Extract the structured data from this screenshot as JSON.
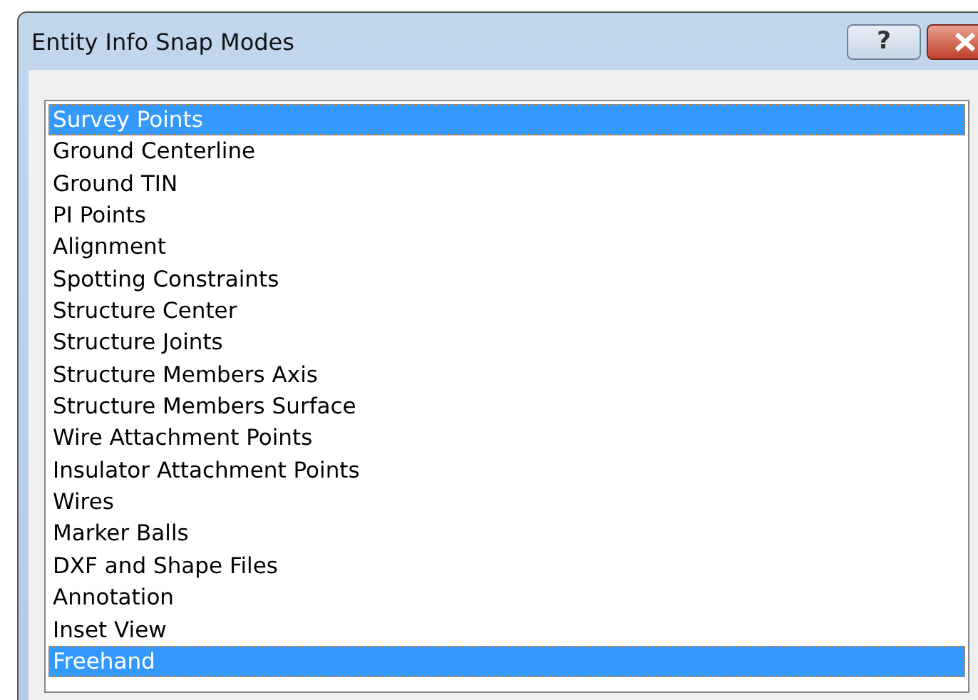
{
  "window": {
    "title": "Entity Info Snap Modes",
    "help_button": "?"
  },
  "snap_modes": [
    {
      "label": "Survey Points",
      "selected": true
    },
    {
      "label": "Ground Centerline",
      "selected": false
    },
    {
      "label": "Ground TIN",
      "selected": false
    },
    {
      "label": "PI Points",
      "selected": false
    },
    {
      "label": "Alignment",
      "selected": false
    },
    {
      "label": "Spotting Constraints",
      "selected": false
    },
    {
      "label": "Structure Center",
      "selected": false
    },
    {
      "label": "Structure Joints",
      "selected": false
    },
    {
      "label": "Structure Members Axis",
      "selected": false
    },
    {
      "label": "Structure Members Surface",
      "selected": false
    },
    {
      "label": "Wire Attachment Points",
      "selected": false
    },
    {
      "label": "Insulator Attachment Points",
      "selected": false
    },
    {
      "label": "Wires",
      "selected": false
    },
    {
      "label": "Marker Balls",
      "selected": false
    },
    {
      "label": "DXF and Shape Files",
      "selected": false
    },
    {
      "label": "Annotation",
      "selected": false
    },
    {
      "label": "Inset View",
      "selected": false
    },
    {
      "label": "Freehand",
      "selected": true
    }
  ]
}
